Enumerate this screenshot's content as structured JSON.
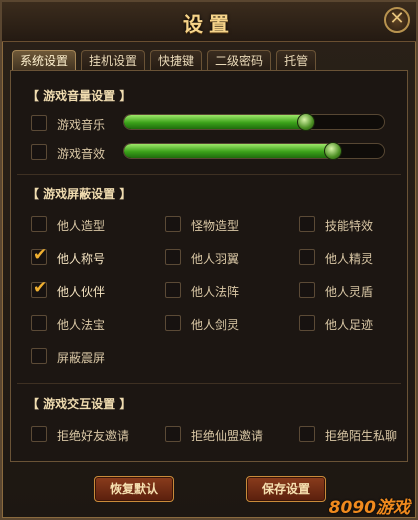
{
  "window": {
    "title": "设置",
    "close_label": "✕"
  },
  "tabs": [
    {
      "label": "系统设置",
      "active": true
    },
    {
      "label": "挂机设置"
    },
    {
      "label": "快捷键"
    },
    {
      "label": "二级密码"
    },
    {
      "label": "托管"
    }
  ],
  "sound": {
    "title": "【 游戏音量设置 】",
    "music": {
      "label": "游戏音乐",
      "checked": false,
      "level": 0.7
    },
    "effects": {
      "label": "游戏音效",
      "checked": false,
      "level": 0.8
    }
  },
  "shield": {
    "title": "【 游戏屏蔽设置 】",
    "items": [
      {
        "label": "他人造型",
        "checked": false
      },
      {
        "label": "怪物造型",
        "checked": false
      },
      {
        "label": "技能特效",
        "checked": false
      },
      {
        "label": "他人称号",
        "checked": true
      },
      {
        "label": "他人羽翼",
        "checked": false
      },
      {
        "label": "他人精灵",
        "checked": false
      },
      {
        "label": "他人伙伴",
        "checked": true
      },
      {
        "label": "他人法阵",
        "checked": false
      },
      {
        "label": "他人灵盾",
        "checked": false
      },
      {
        "label": "他人法宝",
        "checked": false
      },
      {
        "label": "他人剑灵",
        "checked": false
      },
      {
        "label": "他人足迹",
        "checked": false
      },
      {
        "label": "屏蔽震屏",
        "checked": false
      }
    ]
  },
  "interaction": {
    "title": "【 游戏交互设置 】",
    "items": [
      {
        "label": "拒绝好友邀请",
        "checked": false
      },
      {
        "label": "拒绝仙盟邀请",
        "checked": false
      },
      {
        "label": "拒绝陌生私聊",
        "checked": false
      }
    ]
  },
  "buttons": {
    "restore": "恢复默认",
    "save": "保存设置"
  },
  "watermark": "8090游戏",
  "check_glyph": "✔"
}
